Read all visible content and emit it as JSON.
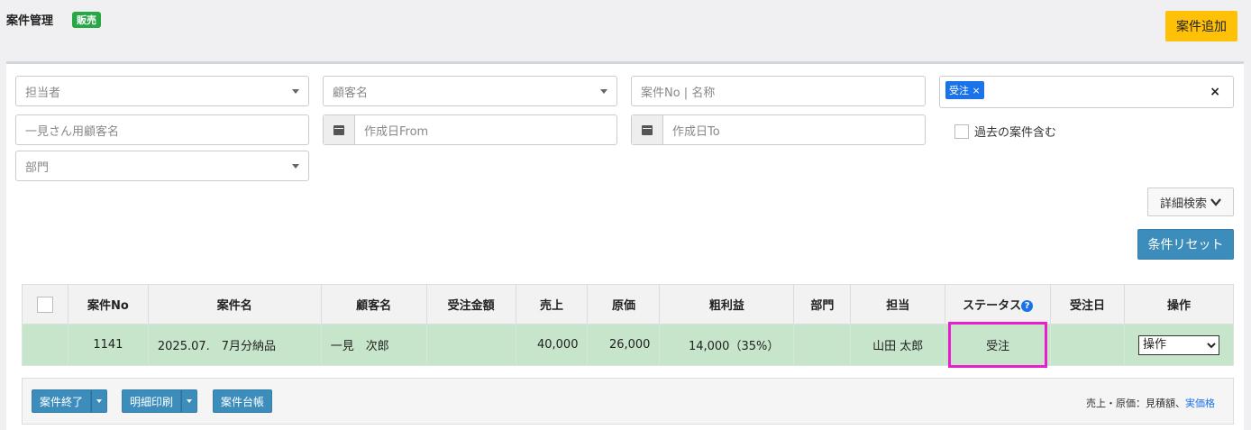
{
  "header": {
    "title": "案件管理",
    "badge": "販売",
    "add_button": "案件追加"
  },
  "filters": {
    "tantousha_placeholder": "担当者",
    "kokyaku_placeholder": "顧客名",
    "anken_placeholder": "案件No | 名称",
    "status_tag": "受注",
    "status_tag_remove": "×",
    "status_clear": "×",
    "ichigen_placeholder": "一見さん用顧客名",
    "date_from_placeholder": "作成日From",
    "date_to_placeholder": "作成日To",
    "include_past_label": "過去の案件含む",
    "bumon_placeholder": "部門",
    "detail_search_label": "詳細検索",
    "reset_label": "条件リセット"
  },
  "table": {
    "headers": [
      "",
      "案件No",
      "案件名",
      "顧客名",
      "受注金額",
      "売上",
      "原価",
      "粗利益",
      "部門",
      "担当",
      "ステータス",
      "受注日",
      "操作"
    ],
    "help_icon": "?",
    "rows": [
      {
        "no": "1141",
        "name": "2025.07.　7月分納品",
        "customer": "一見　次郎",
        "order_amount": "",
        "sales": "40,000",
        "cost": "26,000",
        "profit": "14,000（35%）",
        "dept": "",
        "staff": "山田 太郎",
        "status": "受注",
        "order_date": "",
        "action": "操作"
      }
    ]
  },
  "footer": {
    "close_label": "案件終了",
    "print_label": "明細印刷",
    "ledger_label": "案件台帳",
    "note_text": "売上・原価：見積額、",
    "note_link": "実価格"
  },
  "colors": {
    "accent": "#3c8dbc",
    "add_button": "#ffc107",
    "badge": "#28a745",
    "row_highlight": "#c6e5ca",
    "status_outline": "#e91ecf"
  }
}
